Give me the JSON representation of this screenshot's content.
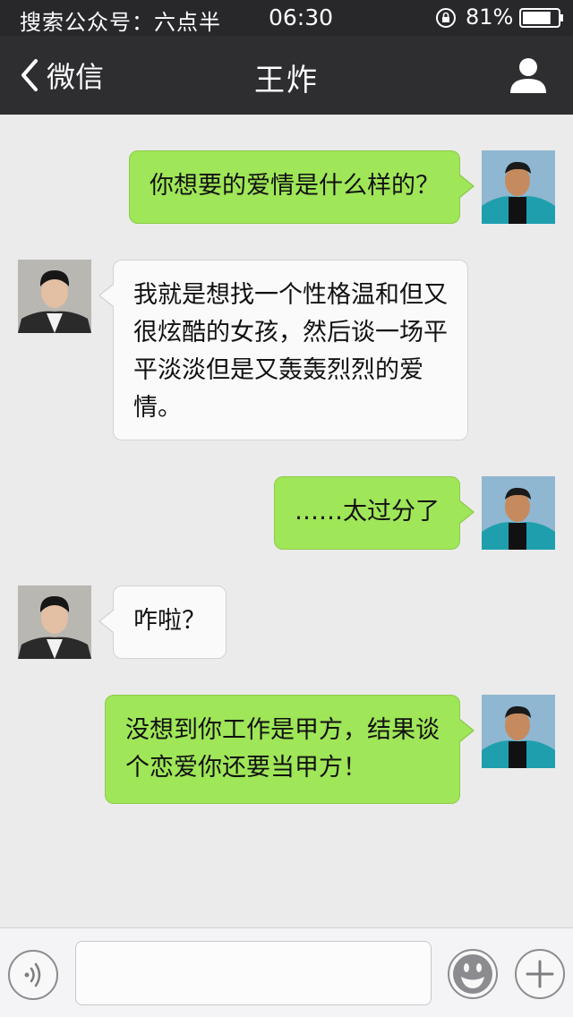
{
  "status_bar": {
    "carrier": "搜索公众号：六点半",
    "time": "06:30",
    "battery_percent": "81%",
    "battery_level": 0.81
  },
  "nav": {
    "back_label": "微信",
    "title": "王炸"
  },
  "messages": [
    {
      "side": "right",
      "text_lines": [
        "你想要的爱情是什么样的？"
      ]
    },
    {
      "side": "left",
      "text_lines": [
        "我就是想找一个性格温和但又",
        "很炫酷的女孩，然后谈一场平",
        "平淡淡但是又轰轰烈烈的爱",
        "情。"
      ]
    },
    {
      "side": "right",
      "text_lines": [
        "……太过分了"
      ]
    },
    {
      "side": "left",
      "text_lines": [
        "咋啦？"
      ]
    },
    {
      "side": "right",
      "text_lines": [
        "没想到你工作是甲方，结果谈",
        "个恋爱你还要当甲方！"
      ]
    }
  ],
  "input": {
    "value": "",
    "placeholder": ""
  },
  "colors": {
    "status_bg": "#28282b",
    "nav_bg": "#2e2e31",
    "chat_bg": "#ebebeb",
    "bubble_sent": "#9fe658",
    "bubble_received": "#fafafa"
  },
  "icons": {
    "back": "chevron-left-icon",
    "profile": "person-icon",
    "voice": "voice-icon",
    "emoji": "smiley-icon",
    "more": "plus-icon",
    "lock": "rotation-lock-icon",
    "battery": "battery-icon"
  }
}
